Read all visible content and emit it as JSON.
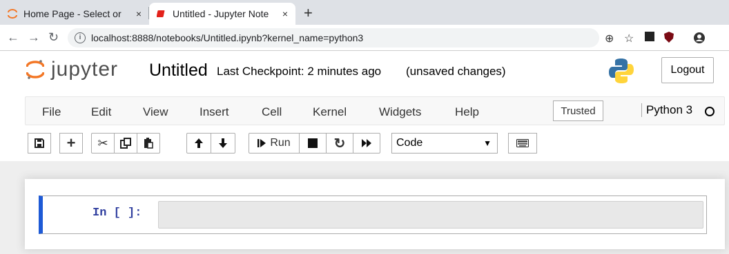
{
  "browser": {
    "tabs": [
      {
        "title": "Home Page - Select or",
        "active": false
      },
      {
        "title": "Untitled - Jupyter Note",
        "active": true
      }
    ],
    "close_glyph": "×",
    "new_tab_glyph": "+",
    "url": "localhost:8888/notebooks/Untitled.ipynb?kernel_name=python3",
    "info_glyph": "i"
  },
  "header": {
    "logo_text": "jupyter",
    "notebook_name": "Untitled",
    "checkpoint": "Last Checkpoint: 2 minutes ago",
    "unsaved": "(unsaved changes)",
    "logout_label": "Logout"
  },
  "menubar": {
    "items": [
      "File",
      "Edit",
      "View",
      "Insert",
      "Cell",
      "Kernel",
      "Widgets",
      "Help"
    ],
    "trusted_label": "Trusted",
    "kernel_name": "Python 3"
  },
  "toolbar": {
    "run_label": "Run",
    "cell_type": "Code",
    "icons": [
      "save-icon",
      "plus-icon",
      "cut-icon",
      "copy-icon",
      "paste-icon",
      "arrow-up-icon",
      "arrow-down-icon",
      "step-icon",
      "stop-icon",
      "restart-icon",
      "fast-forward-icon",
      "keyboard-icon"
    ]
  },
  "cell": {
    "prompt": "In [ ]:",
    "source": ""
  },
  "colors": {
    "accent": "#1e5ad6",
    "prompt": "#303f9f",
    "jupyter_orange": "#f37726"
  }
}
